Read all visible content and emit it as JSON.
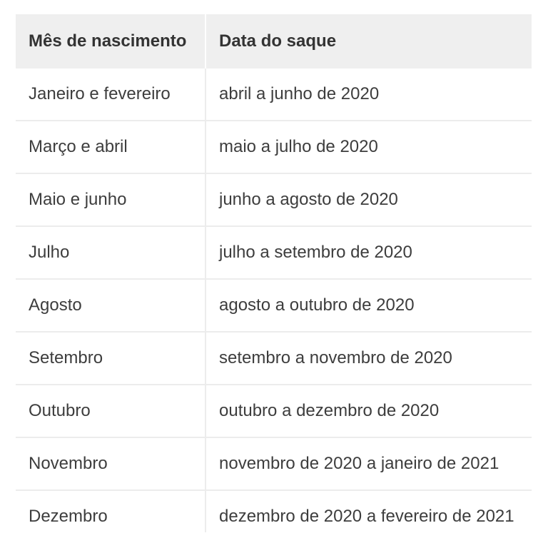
{
  "table": {
    "headers": [
      "Mês de nascimento",
      "Data do saque"
    ],
    "rows": [
      [
        "Janeiro e fevereiro",
        "abril a junho de 2020"
      ],
      [
        "Março e abril",
        "maio a julho de 2020"
      ],
      [
        "Maio e junho",
        "junho a agosto de 2020"
      ],
      [
        "Julho",
        "julho a setembro de 2020"
      ],
      [
        "Agosto",
        "agosto a outubro de 2020"
      ],
      [
        "Setembro",
        "setembro a novembro de 2020"
      ],
      [
        "Outubro",
        "outubro a dezembro de 2020"
      ],
      [
        "Novembro",
        "novembro de 2020 a janeiro de 2021"
      ],
      [
        "Dezembro",
        "dezembro de 2020 a fevereiro de 2021"
      ]
    ]
  },
  "colors": {
    "header_background": "#efefef",
    "row_divider": "#ececec",
    "text": "#3d3d3d"
  }
}
